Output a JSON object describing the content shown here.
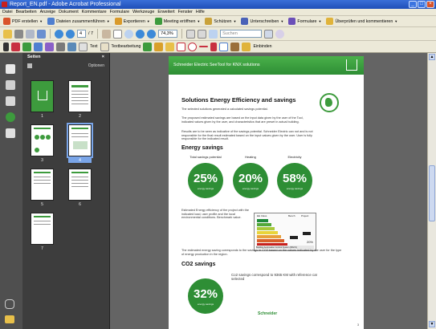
{
  "window": {
    "title": "Report_EN.pdf - Adobe Acrobat Professional"
  },
  "menu": [
    "Datei",
    "Bearbeiten",
    "Anzeige",
    "Dokument",
    "Kommentare",
    "Formulare",
    "Werkzeuge",
    "Erweitert",
    "Fenster",
    "Hilfe"
  ],
  "tasks": [
    {
      "label": "PDF erstellen",
      "color": "#d9532a"
    },
    {
      "label": "Dateien zusammenführen",
      "color": "#4f7fd0"
    },
    {
      "label": "Exportieren",
      "color": "#d99a2a"
    },
    {
      "label": "Meeting eröffnen",
      "color": "#3d9b3d"
    },
    {
      "label": "Schützen",
      "color": "#c9a23a"
    },
    {
      "label": "Unterschreiben",
      "color": "#4a62b8"
    },
    {
      "label": "Formulare",
      "color": "#6b4fb8"
    },
    {
      "label": "Überprüfen und kommentieren",
      "color": "#e0b33a"
    }
  ],
  "std_toolbar": {
    "page_current": "4",
    "page_total": "/ 7",
    "zoom": "74,3%",
    "search_placeholder": "Suchen"
  },
  "tool_toolbar": {
    "select_label": "Text",
    "edit_label": "Textbearbeitung",
    "sign_label": "Einbinden"
  },
  "panel": {
    "title": "Seiten",
    "options": "Optionen"
  },
  "thumbnails": [
    {
      "num": "1",
      "selected": false
    },
    {
      "num": "2",
      "selected": false
    },
    {
      "num": "3",
      "selected": false
    },
    {
      "num": "4",
      "selected": true
    },
    {
      "num": "5",
      "selected": false
    },
    {
      "num": "6",
      "selected": false
    },
    {
      "num": "7",
      "selected": false
    }
  ],
  "page": {
    "banner": "Schneider Electric SeeTool for KNX solutions",
    "heading": "Solutions Energy Efficiency and savings",
    "intro": "The selected solutions generated a calculated savings potential.",
    "para1": "The proposed estimated savings are based on the input data given by the user of the Tool, indicated values given by the user, and characteristics that are preset in actual building.",
    "para2": "Results are to be seen as indicative of the savings potential. Schneider Electric can not and is not responsible for the final result estimated based on the input values given by the user. User is fully responsible for the indicated result.",
    "energy_heading": "Energy savings",
    "gauges": [
      {
        "label": "Total savings potential",
        "value": "25%"
      },
      {
        "label": "Heating",
        "value": "20%"
      },
      {
        "label": "Electricity",
        "value": "58%"
      }
    ],
    "gauge_sub": "energy savings",
    "efficiency_text": "Estimated Energy efficiency of the project with the indicated load, user profile and the local environmental conditions. Benchmark value.",
    "table_header": [
      "EE Class",
      "Bench",
      "Project"
    ],
    "table_footer": "Building Automation Control System (BACS)",
    "table_pct": "20%",
    "co2_text": "The estimated energy saving corresponds to the savings in CO2 based on the values indicated by the user for the type of energy production in the region.",
    "co2_heading": "CO2 savings",
    "co2_note": "Co2 savings correspond to 9365 KM with reference car selected",
    "co2_value": "32%",
    "brand": "Schneider",
    "page_number": "3"
  },
  "colors": {
    "green": "#2e8e35",
    "panel": "#3d3d3d",
    "chrome": "#ece9d8",
    "titlebar": "#2a5fc8"
  }
}
